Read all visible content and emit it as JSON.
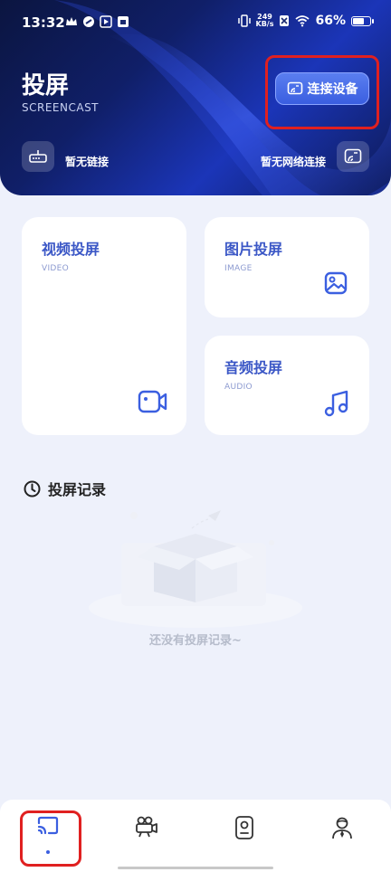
{
  "status_bar": {
    "time": "13:32",
    "net_speed_value": "249",
    "net_speed_unit": "KB/s",
    "battery": "66%"
  },
  "header": {
    "title": "投屏",
    "subtitle": "SCREENCAST",
    "connect_button": "连接设备",
    "link_status": "暂无链接",
    "network_status": "暂无网络连接"
  },
  "cards": {
    "video": {
      "title": "视频投屏",
      "subtitle": "VIDEO"
    },
    "image": {
      "title": "图片投屏",
      "subtitle": "IMAGE"
    },
    "audio": {
      "title": "音频投屏",
      "subtitle": "AUDIO"
    }
  },
  "history": {
    "title": "投屏记录",
    "empty_text": "还没有投屏记录~"
  },
  "bottom_nav": {
    "items": [
      {
        "icon": "cast-icon",
        "active": true
      },
      {
        "icon": "video-camera-icon",
        "active": false
      },
      {
        "icon": "remote-control-icon",
        "active": false
      },
      {
        "icon": "user-profile-icon",
        "active": false
      }
    ]
  },
  "colors": {
    "accent": "#3b5fe0",
    "card_title": "#3b57c6",
    "highlight": "#e02020"
  }
}
